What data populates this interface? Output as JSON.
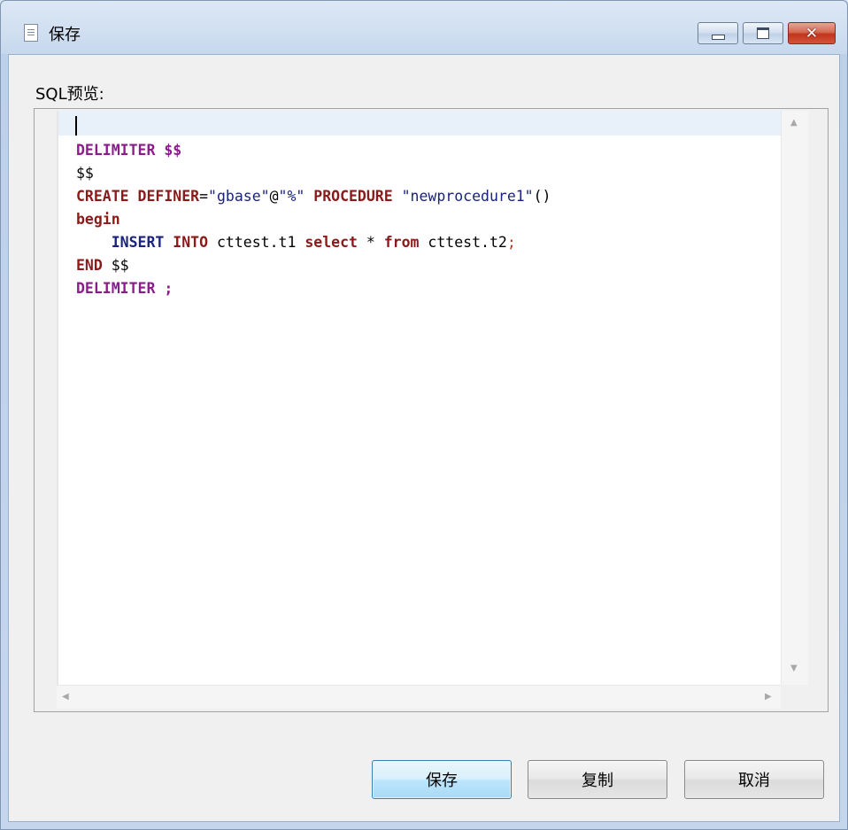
{
  "window": {
    "title": "保存",
    "controls": {
      "minimize": "minimize",
      "maximize": "maximize",
      "close": "✕"
    }
  },
  "dialog": {
    "sql_label": "SQL预览:",
    "buttons": {
      "save": "保存",
      "copy": "复制",
      "cancel": "取消"
    }
  },
  "editor": {
    "lines": [
      [],
      [
        {
          "t": "DELIMITER ",
          "c": "kw-purple"
        },
        {
          "t": "$$",
          "c": "kw-purple"
        }
      ],
      [
        {
          "t": "$$",
          "c": "plain"
        }
      ],
      [
        {
          "t": "CREATE ",
          "c": "kw-red"
        },
        {
          "t": "DEFINER",
          "c": "kw-red"
        },
        {
          "t": "=",
          "c": "plain"
        },
        {
          "t": "\"gbase\"",
          "c": "str"
        },
        {
          "t": "@",
          "c": "plain"
        },
        {
          "t": "\"%\"",
          "c": "str"
        },
        {
          "t": " ",
          "c": "plain"
        },
        {
          "t": "PROCEDURE",
          "c": "kw-red"
        },
        {
          "t": " ",
          "c": "plain"
        },
        {
          "t": "\"newprocedure1\"",
          "c": "str"
        },
        {
          "t": "()",
          "c": "plain"
        }
      ],
      [
        {
          "t": "begin",
          "c": "kw-red"
        }
      ],
      [
        {
          "t": "    ",
          "c": "plain"
        },
        {
          "t": "INSERT",
          "c": "kw-blue"
        },
        {
          "t": " ",
          "c": "plain"
        },
        {
          "t": "INTO",
          "c": "kw-red"
        },
        {
          "t": " cttest.t1 ",
          "c": "plain"
        },
        {
          "t": "select",
          "c": "kw-red"
        },
        {
          "t": " * ",
          "c": "plain"
        },
        {
          "t": "from",
          "c": "kw-red"
        },
        {
          "t": " cttest.t2",
          "c": "plain"
        },
        {
          "t": ";",
          "c": "semi-red"
        }
      ],
      [
        {
          "t": "END",
          "c": "kw-red"
        },
        {
          "t": " $$",
          "c": "plain"
        }
      ],
      [
        {
          "t": "DELIMITER ;",
          "c": "kw-purple"
        }
      ]
    ]
  }
}
